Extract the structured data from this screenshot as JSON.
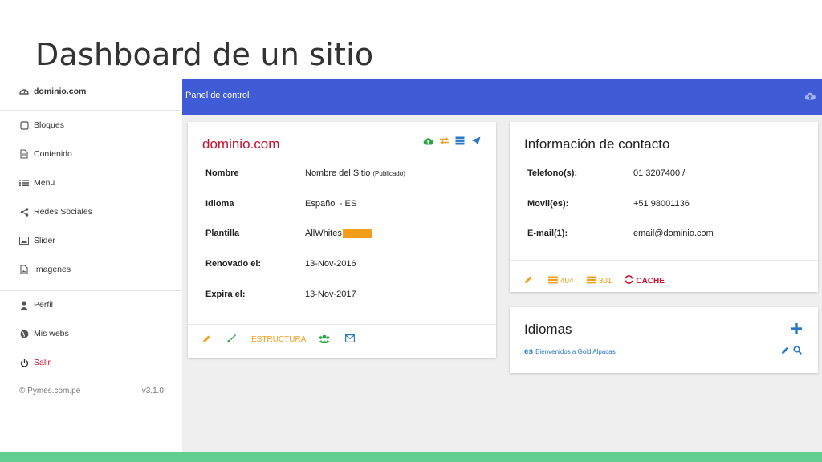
{
  "slide_title": "Dashboard de un sitio",
  "sidebar": {
    "brand": "dominio.com",
    "items": [
      {
        "label": "Bloques"
      },
      {
        "label": "Contenido"
      },
      {
        "label": "Menu"
      },
      {
        "label": "Redes Sociales"
      },
      {
        "label": "Slider"
      },
      {
        "label": "Imagenes"
      }
    ],
    "account": [
      {
        "label": "Perfil"
      },
      {
        "label": "Mis webs"
      },
      {
        "label": "Salir"
      }
    ],
    "footer_copyright": "© Pymes.com.pe",
    "footer_version": "v3.1.0"
  },
  "topbar": {
    "title": "Panel de control"
  },
  "site_card": {
    "title": "dominio.com",
    "rows": [
      {
        "label": "Nombre",
        "value": "Nombre del Sitio",
        "note": "(Publicado)"
      },
      {
        "label": "Idioma",
        "value": "Español - ES"
      },
      {
        "label": "Plantilla",
        "value": "AllWhites"
      },
      {
        "label": "Renovado el:",
        "value": "13-Nov-2016"
      },
      {
        "label": "Expira el:",
        "value": "13-Nov-2017"
      }
    ],
    "template_color": "#f29e1b",
    "footer": {
      "structure_label": "ESTRUCTURA"
    }
  },
  "contact_card": {
    "title": "Información de contacto",
    "rows": [
      {
        "label": "Telefono(s):",
        "value": "01 3207400 /"
      },
      {
        "label": "Movil(es):",
        "value": "+51 98001136"
      },
      {
        "label": "E-mail(1):",
        "value": "email@dominio.com"
      }
    ],
    "footer": {
      "e404": "404",
      "e301": "301",
      "cache": "CACHE"
    }
  },
  "languages_card": {
    "title": "Idiomas",
    "items": [
      {
        "code": "es",
        "text": "Bienvenidos a Gold Alpacas"
      }
    ]
  },
  "colors": {
    "accent_blue": "#3f5bd5",
    "brand_red": "#c8102e",
    "orange": "#f29e1b",
    "green": "#27a844",
    "link_blue": "#2a78c6",
    "bottom_bar": "#5fce8e"
  }
}
